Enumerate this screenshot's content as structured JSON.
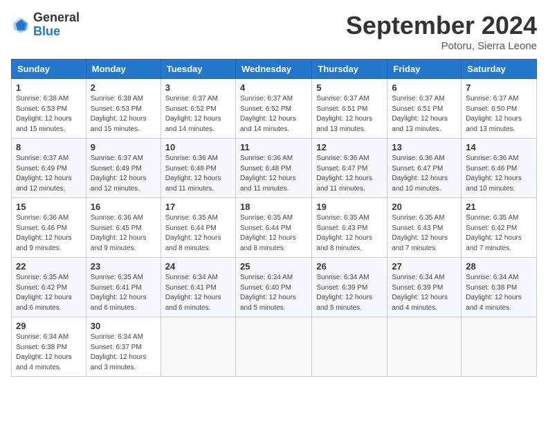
{
  "header": {
    "logo": {
      "general": "General",
      "blue": "Blue"
    },
    "title": "September 2024",
    "location": "Potoru, Sierra Leone"
  },
  "calendar": {
    "days_of_week": [
      "Sunday",
      "Monday",
      "Tuesday",
      "Wednesday",
      "Thursday",
      "Friday",
      "Saturday"
    ],
    "weeks": [
      [
        {
          "day": "1",
          "sunrise": "6:38 AM",
          "sunset": "6:53 PM",
          "daylight": "12 hours and 15 minutes."
        },
        {
          "day": "2",
          "sunrise": "6:38 AM",
          "sunset": "6:53 PM",
          "daylight": "12 hours and 15 minutes."
        },
        {
          "day": "3",
          "sunrise": "6:37 AM",
          "sunset": "6:52 PM",
          "daylight": "12 hours and 14 minutes."
        },
        {
          "day": "4",
          "sunrise": "6:37 AM",
          "sunset": "6:52 PM",
          "daylight": "12 hours and 14 minutes."
        },
        {
          "day": "5",
          "sunrise": "6:37 AM",
          "sunset": "6:51 PM",
          "daylight": "12 hours and 13 minutes."
        },
        {
          "day": "6",
          "sunrise": "6:37 AM",
          "sunset": "6:51 PM",
          "daylight": "12 hours and 13 minutes."
        },
        {
          "day": "7",
          "sunrise": "6:37 AM",
          "sunset": "6:50 PM",
          "daylight": "12 hours and 13 minutes."
        }
      ],
      [
        {
          "day": "8",
          "sunrise": "6:37 AM",
          "sunset": "6:49 PM",
          "daylight": "12 hours and 12 minutes."
        },
        {
          "day": "9",
          "sunrise": "6:37 AM",
          "sunset": "6:49 PM",
          "daylight": "12 hours and 12 minutes."
        },
        {
          "day": "10",
          "sunrise": "6:36 AM",
          "sunset": "6:48 PM",
          "daylight": "12 hours and 11 minutes."
        },
        {
          "day": "11",
          "sunrise": "6:36 AM",
          "sunset": "6:48 PM",
          "daylight": "12 hours and 11 minutes."
        },
        {
          "day": "12",
          "sunrise": "6:36 AM",
          "sunset": "6:47 PM",
          "daylight": "12 hours and 11 minutes."
        },
        {
          "day": "13",
          "sunrise": "6:36 AM",
          "sunset": "6:47 PM",
          "daylight": "12 hours and 10 minutes."
        },
        {
          "day": "14",
          "sunrise": "6:36 AM",
          "sunset": "6:46 PM",
          "daylight": "12 hours and 10 minutes."
        }
      ],
      [
        {
          "day": "15",
          "sunrise": "6:36 AM",
          "sunset": "6:46 PM",
          "daylight": "12 hours and 9 minutes."
        },
        {
          "day": "16",
          "sunrise": "6:36 AM",
          "sunset": "6:45 PM",
          "daylight": "12 hours and 9 minutes."
        },
        {
          "day": "17",
          "sunrise": "6:35 AM",
          "sunset": "6:44 PM",
          "daylight": "12 hours and 8 minutes."
        },
        {
          "day": "18",
          "sunrise": "6:35 AM",
          "sunset": "6:44 PM",
          "daylight": "12 hours and 8 minutes."
        },
        {
          "day": "19",
          "sunrise": "6:35 AM",
          "sunset": "6:43 PM",
          "daylight": "12 hours and 8 minutes."
        },
        {
          "day": "20",
          "sunrise": "6:35 AM",
          "sunset": "6:43 PM",
          "daylight": "12 hours and 7 minutes."
        },
        {
          "day": "21",
          "sunrise": "6:35 AM",
          "sunset": "6:42 PM",
          "daylight": "12 hours and 7 minutes."
        }
      ],
      [
        {
          "day": "22",
          "sunrise": "6:35 AM",
          "sunset": "6:42 PM",
          "daylight": "12 hours and 6 minutes."
        },
        {
          "day": "23",
          "sunrise": "6:35 AM",
          "sunset": "6:41 PM",
          "daylight": "12 hours and 6 minutes."
        },
        {
          "day": "24",
          "sunrise": "6:34 AM",
          "sunset": "6:41 PM",
          "daylight": "12 hours and 6 minutes."
        },
        {
          "day": "25",
          "sunrise": "6:34 AM",
          "sunset": "6:40 PM",
          "daylight": "12 hours and 5 minutes."
        },
        {
          "day": "26",
          "sunrise": "6:34 AM",
          "sunset": "6:39 PM",
          "daylight": "12 hours and 5 minutes."
        },
        {
          "day": "27",
          "sunrise": "6:34 AM",
          "sunset": "6:39 PM",
          "daylight": "12 hours and 4 minutes."
        },
        {
          "day": "28",
          "sunrise": "6:34 AM",
          "sunset": "6:38 PM",
          "daylight": "12 hours and 4 minutes."
        }
      ],
      [
        {
          "day": "29",
          "sunrise": "6:34 AM",
          "sunset": "6:38 PM",
          "daylight": "12 hours and 4 minutes."
        },
        {
          "day": "30",
          "sunrise": "6:34 AM",
          "sunset": "6:37 PM",
          "daylight": "12 hours and 3 minutes."
        },
        null,
        null,
        null,
        null,
        null
      ]
    ]
  }
}
